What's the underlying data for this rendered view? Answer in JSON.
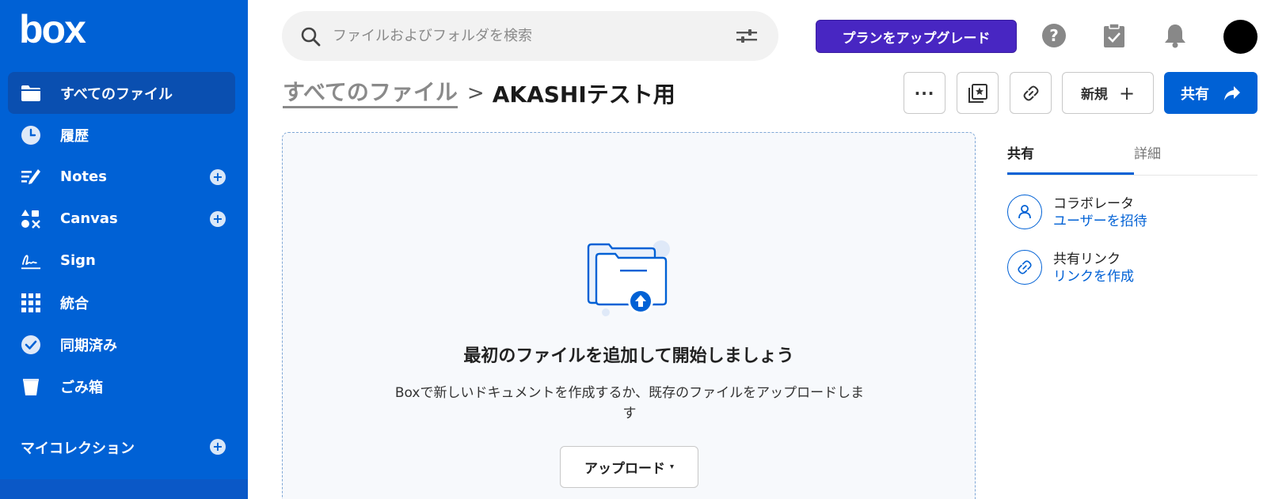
{
  "app": {
    "logo": "box"
  },
  "sidebar": {
    "items": [
      {
        "label": "すべてのファイル",
        "icon": "folder-icon"
      },
      {
        "label": "履歴",
        "icon": "clock-icon"
      },
      {
        "label": "Notes",
        "icon": "notes-icon"
      },
      {
        "label": "Canvas",
        "icon": "canvas-icon"
      },
      {
        "label": "Sign",
        "icon": "sign-icon"
      },
      {
        "label": "統合",
        "icon": "grid-icon"
      },
      {
        "label": "同期済み",
        "icon": "check-circle-icon"
      },
      {
        "label": "ごみ箱",
        "icon": "trash-icon"
      }
    ],
    "collections_label": "マイコレクション"
  },
  "search": {
    "placeholder": "ファイルおよびフォルダを検索"
  },
  "header": {
    "upgrade_label": "プランをアップグレード",
    "breadcrumb_root": "すべてのファイル",
    "breadcrumb_sep": ">",
    "breadcrumb_current": "AKASHIテスト用",
    "more_label": "···",
    "new_label": "新規",
    "new_plus": "+",
    "share_label": "共有"
  },
  "empty_state": {
    "title": "最初のファイルを追加して開始しましょう",
    "description": "Boxで新しいドキュメントを作成するか、既存のファイルをアップロードします",
    "upload_label": "アップロード",
    "upload_caret": "▾"
  },
  "panel": {
    "tabs": [
      "共有",
      "詳細"
    ],
    "collaborators_title": "コラボレータ",
    "collaborators_link": "ユーザーを招待",
    "shared_link_title": "共有リンク",
    "shared_link_link": "リンクを作成"
  },
  "colors": {
    "brand": "#0061d5",
    "upgrade": "#4826c2",
    "sidebar_active": "#0a4fb0"
  }
}
